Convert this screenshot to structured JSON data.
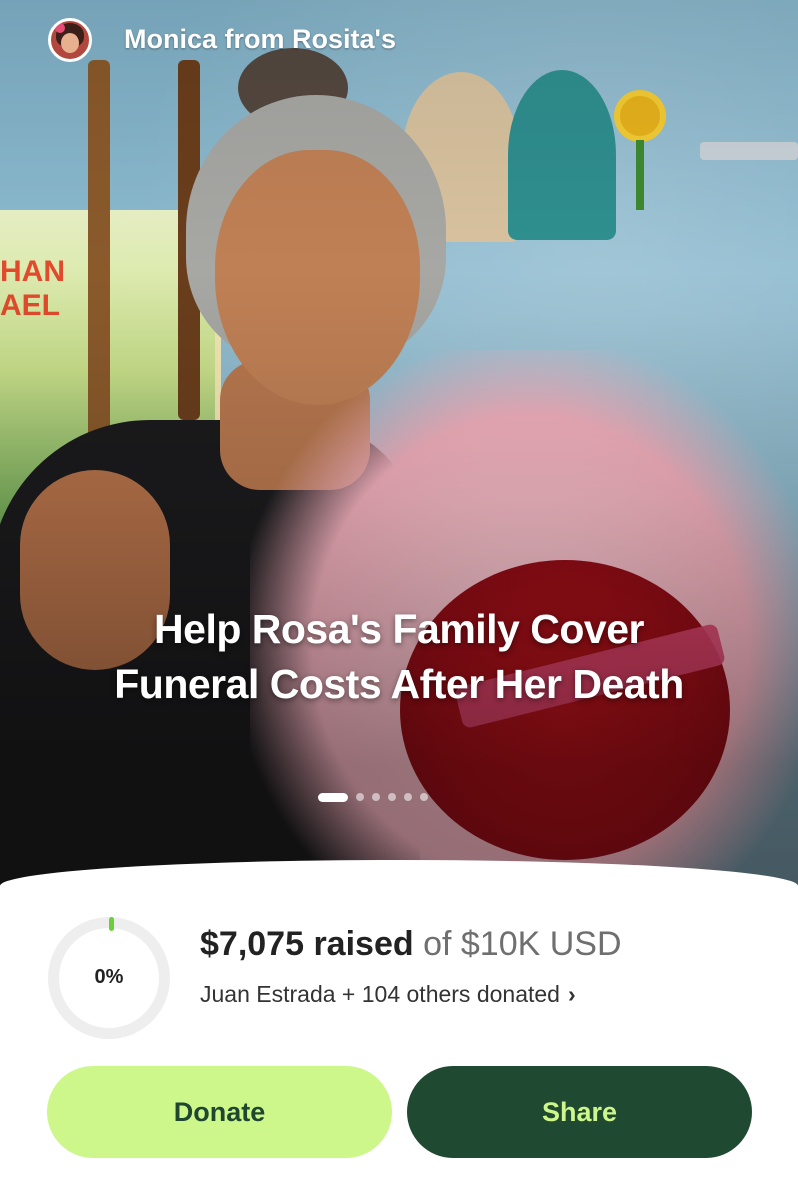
{
  "header": {
    "organizer": "Monica from Rosita's"
  },
  "hero": {
    "title": "Help Rosa's Family Cover Funeral Costs After Her Death",
    "slides_count": 6,
    "active_slide": 1
  },
  "progress": {
    "percent_label": "0%",
    "raised_amount": "$7,075",
    "raised_word": "raised",
    "goal_text": "of $10K USD",
    "donors_text": "Juan Estrada + 104 others donated",
    "donors_chevron": "›"
  },
  "actions": {
    "donate_label": "Donate",
    "share_label": "Share"
  },
  "colors": {
    "donate_bg": "#cdf68b",
    "share_bg": "#1f4a31",
    "accent_green": "#6ccf3a"
  },
  "icons": {
    "avatar": "organizer-avatar",
    "chevron": "chevron-right-icon"
  }
}
